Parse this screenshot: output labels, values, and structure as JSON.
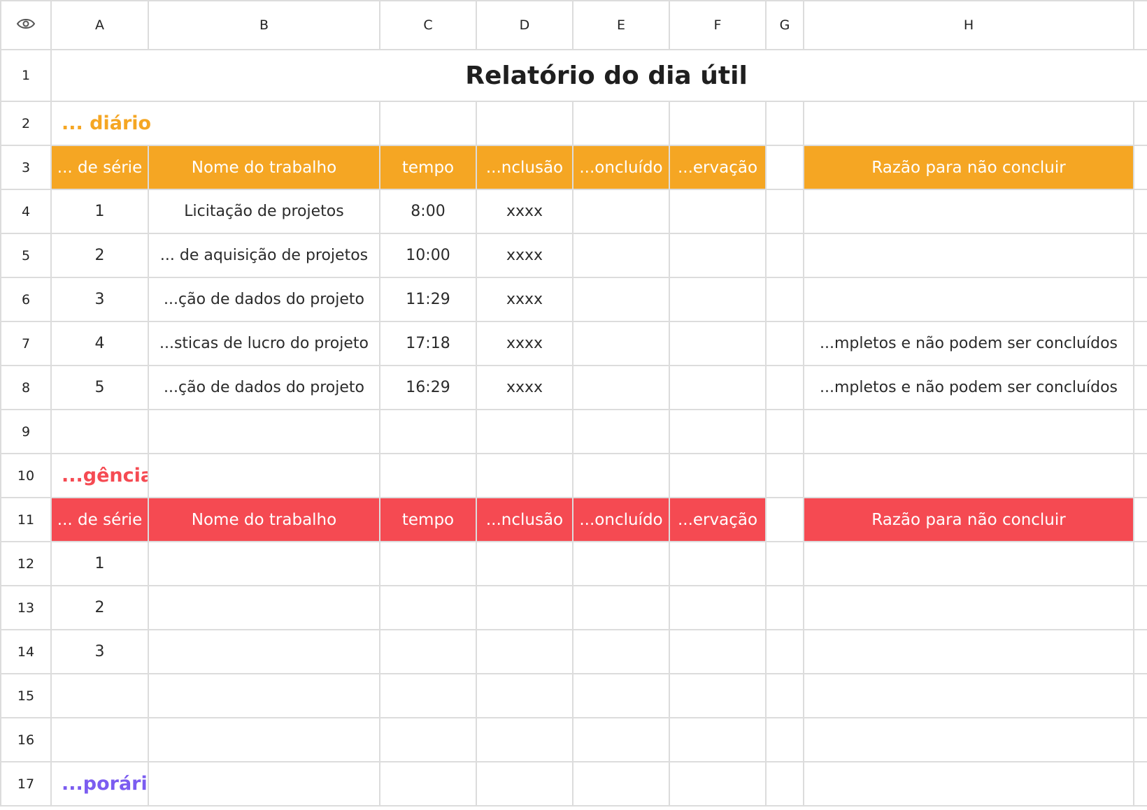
{
  "columns": [
    "A",
    "B",
    "C",
    "D",
    "E",
    "F",
    "G",
    "H"
  ],
  "row_numbers": [
    "1",
    "2",
    "3",
    "4",
    "5",
    "6",
    "7",
    "8",
    "9",
    "10",
    "11",
    "12",
    "13",
    "14",
    "15",
    "16",
    "17"
  ],
  "title": "Relatório do dia útil",
  "daily": {
    "section_label": "... diário",
    "header": {
      "serial": "... de série",
      "name": "Nome do trabalho",
      "time": "tempo",
      "conclusion": "...nclusão",
      "completed": "...oncluído",
      "observation": "...ervação",
      "reason": "Razão para não concluir"
    },
    "rows": [
      {
        "serial": "1",
        "name": "Licitação de projetos",
        "time": "8:00",
        "conclusion": "xxxx",
        "completed": "",
        "observation": "",
        "reason": ""
      },
      {
        "serial": "2",
        "name": "... de aquisição de projetos",
        "time": "10:00",
        "conclusion": "xxxx",
        "completed": "",
        "observation": "",
        "reason": ""
      },
      {
        "serial": "3",
        "name": "...ção de dados do projeto",
        "time": "11:29",
        "conclusion": "xxxx",
        "completed": "",
        "observation": "",
        "reason": ""
      },
      {
        "serial": "4",
        "name": "...sticas de lucro do projeto",
        "time": "17:18",
        "conclusion": "xxxx",
        "completed": "",
        "observation": "",
        "reason": "...mpletos e não podem ser concluídos"
      },
      {
        "serial": "5",
        "name": "...ção de dados do projeto",
        "time": "16:29",
        "conclusion": "xxxx",
        "completed": "",
        "observation": "",
        "reason": "...mpletos e não podem ser concluídos"
      }
    ]
  },
  "urgent": {
    "section_label": "...gência",
    "header": {
      "serial": "... de série",
      "name": "Nome do trabalho",
      "time": "tempo",
      "conclusion": "...nclusão",
      "completed": "...oncluído",
      "observation": "...ervação",
      "reason": "Razão para não concluir"
    },
    "rows": [
      {
        "serial": "1"
      },
      {
        "serial": "2"
      },
      {
        "serial": "3"
      }
    ]
  },
  "temporary": {
    "section_label": "...porário"
  },
  "colors": {
    "daily_accent": "#f5a623",
    "urgent_accent": "#f54a52",
    "temporary_accent": "#7b5cf0",
    "grid": "#dcdcdc"
  },
  "icons": {
    "corner": "eye-icon"
  }
}
